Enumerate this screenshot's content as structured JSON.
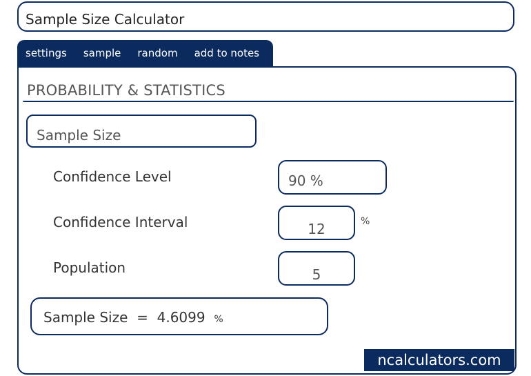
{
  "header": {
    "title": "Sample Size Calculator"
  },
  "tabs": [
    {
      "label": "settings"
    },
    {
      "label": "sample"
    },
    {
      "label": "random"
    },
    {
      "label": "add to notes"
    }
  ],
  "section": {
    "title": "PROBABILITY & STATISTICS"
  },
  "calculator": {
    "name": "Sample Size",
    "fields": [
      {
        "label": "Confidence Level",
        "value": "90 %",
        "unit": ""
      },
      {
        "label": "Confidence Interval",
        "value": "12",
        "unit": "%"
      },
      {
        "label": "Population",
        "value": "5",
        "unit": ""
      }
    ],
    "result": {
      "label": "Sample Size",
      "equals": "=",
      "value": "4.6099",
      "unit": "%"
    }
  },
  "brand": {
    "text": "ncalculators.com"
  },
  "colors": {
    "accent": "#0b2a5e"
  }
}
